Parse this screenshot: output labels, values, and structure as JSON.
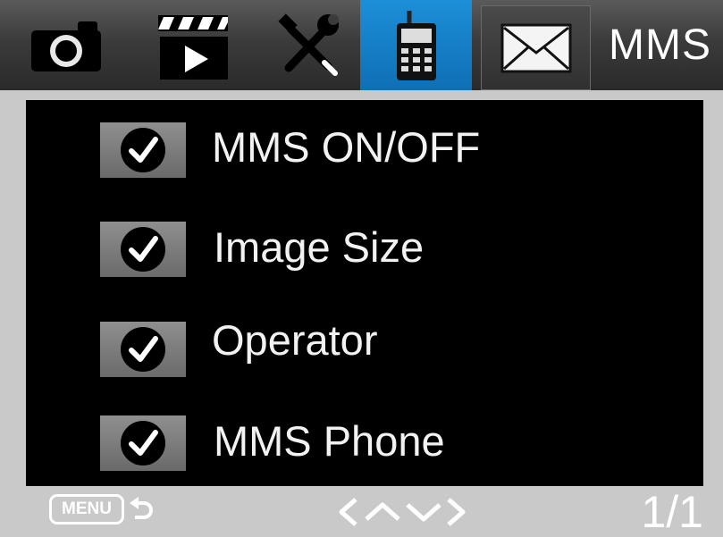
{
  "tabs": [
    {
      "icon": "camera-icon",
      "label": ""
    },
    {
      "icon": "video-clapper-icon",
      "label": ""
    },
    {
      "icon": "tools-icon",
      "label": ""
    },
    {
      "icon": "cellular-network-icon",
      "label": "",
      "active": true
    },
    {
      "icon": "mail-icon",
      "label": ""
    }
  ],
  "header": {
    "title": "MMS"
  },
  "menu": {
    "items": [
      {
        "label": "MMS ON/OFF",
        "checked": true
      },
      {
        "label": "Image Size",
        "checked": true
      },
      {
        "label": "Operator",
        "checked": true
      },
      {
        "label": "MMS Phone",
        "checked": true
      }
    ]
  },
  "footer": {
    "menu_label": "MENU",
    "back_icon": "return-arrow-icon",
    "nav_icons": [
      "chevron-left-icon",
      "chevron-up-icon",
      "chevron-down-icon",
      "chevron-right-icon"
    ],
    "page": "1/1"
  },
  "colors": {
    "active_tab": "#1c8fd8",
    "panel": "#000000",
    "chrome": "#c9c9c9",
    "text": "#ffffff"
  }
}
